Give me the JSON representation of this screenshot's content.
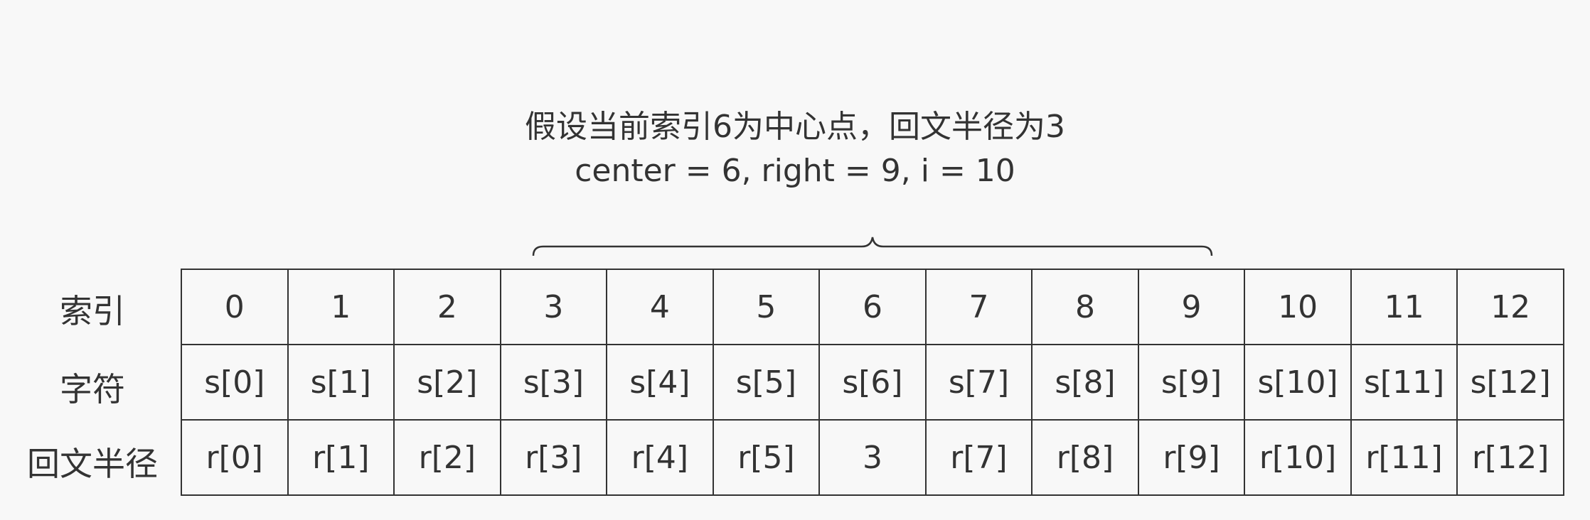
{
  "caption": {
    "line1": "假设当前索引6为中心点，回文半径为3",
    "line2": "center = 6, right = 9, i = 10"
  },
  "row_labels": {
    "index": "索引",
    "char": "字符",
    "radius": "回文半径"
  },
  "rows": {
    "index": [
      "0",
      "1",
      "2",
      "3",
      "4",
      "5",
      "6",
      "7",
      "8",
      "9",
      "10",
      "11",
      "12"
    ],
    "char": [
      "s[0]",
      "s[1]",
      "s[2]",
      "s[3]",
      "s[4]",
      "s[5]",
      "s[6]",
      "s[7]",
      "s[8]",
      "s[9]",
      "s[10]",
      "s[11]",
      "s[12]"
    ],
    "radius": [
      "r[0]",
      "r[1]",
      "r[2]",
      "r[3]",
      "r[4]",
      "r[5]",
      "3",
      "r[7]",
      "r[8]",
      "r[9]",
      "r[10]",
      "r[11]",
      "r[12]"
    ]
  },
  "colors": {
    "line": "#333333",
    "text": "#333333",
    "background": "#f8f8f8"
  }
}
